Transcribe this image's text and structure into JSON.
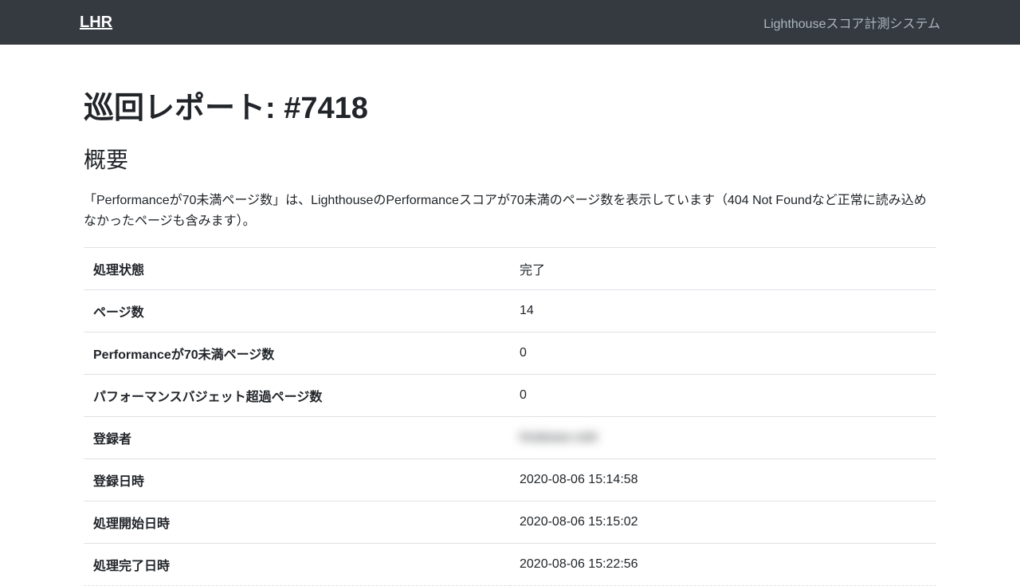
{
  "navbar": {
    "brand": "LHR",
    "subtitle": "Lighthouseスコア計測システム"
  },
  "page": {
    "title": "巡回レポート: #7418",
    "section_title": "概要",
    "description": "「Performanceが70未満ページ数」は、LighthouseのPerformanceスコアが70未満のページ数を表示しています（404 Not Foundなど正常に読み込めなかったページも含みます）。"
  },
  "summary": {
    "rows": [
      {
        "label": "処理状態",
        "value": "完了",
        "value_class": "text-success"
      },
      {
        "label": "ページ数",
        "value": "14",
        "value_class": ""
      },
      {
        "label": "Performanceが70未満ページ数",
        "value": "0",
        "value_class": ""
      },
      {
        "label": "パフォーマンスバジェット超過ページ数",
        "value": "0",
        "value_class": ""
      },
      {
        "label": "登録者",
        "value": "hirakawa ooki",
        "value_class": "blurred"
      },
      {
        "label": "登録日時",
        "value": "2020-08-06 15:14:58",
        "value_class": ""
      },
      {
        "label": "処理開始日時",
        "value": "2020-08-06 15:15:02",
        "value_class": ""
      },
      {
        "label": "処理完了日時",
        "value": "2020-08-06 15:22:56",
        "value_class": ""
      }
    ]
  }
}
